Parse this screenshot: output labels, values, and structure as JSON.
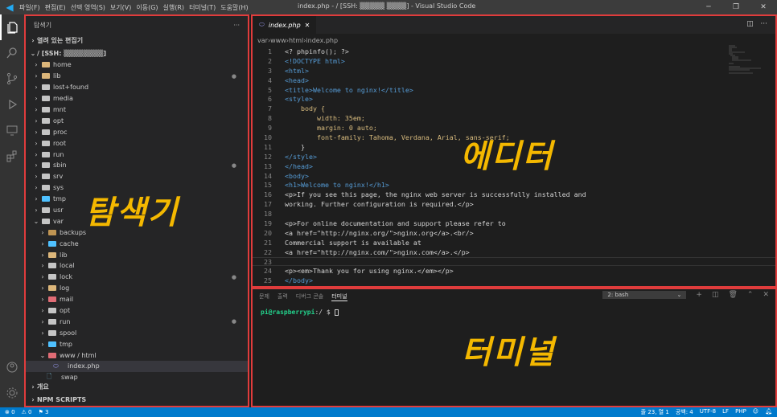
{
  "titlebar": {
    "menu": [
      "파일(F)",
      "편집(E)",
      "선택 영역(S)",
      "보기(V)",
      "이동(G)",
      "실행(R)",
      "터미널(T)",
      "도움말(H)"
    ],
    "title": "index.php - / [SSH: ▒▒▒▒▒ ▒▒▒▒] - Visual Studio Code"
  },
  "sidebar": {
    "title": "탐색기",
    "open_editors": "열려 있는 편집기",
    "root": "/ [SSH: ▒▒▒▒▒▒▒▒]",
    "items": [
      {
        "label": "home",
        "depth": 0,
        "color": "#dcb67a"
      },
      {
        "label": "lib",
        "depth": 0,
        "color": "#dcb67a",
        "dot": true
      },
      {
        "label": "lost+found",
        "depth": 0,
        "color": "#c5c5c5"
      },
      {
        "label": "media",
        "depth": 0,
        "color": "#c5c5c5"
      },
      {
        "label": "mnt",
        "depth": 0,
        "color": "#c5c5c5"
      },
      {
        "label": "opt",
        "depth": 0,
        "color": "#c5c5c5"
      },
      {
        "label": "proc",
        "depth": 0,
        "color": "#c5c5c5"
      },
      {
        "label": "root",
        "depth": 0,
        "color": "#c5c5c5"
      },
      {
        "label": "run",
        "depth": 0,
        "color": "#c5c5c5"
      },
      {
        "label": "sbin",
        "depth": 0,
        "color": "#c5c5c5",
        "dot": true
      },
      {
        "label": "srv",
        "depth": 0,
        "color": "#c5c5c5"
      },
      {
        "label": "sys",
        "depth": 0,
        "color": "#c5c5c5"
      },
      {
        "label": "tmp",
        "depth": 0,
        "color": "#4fc1ff"
      },
      {
        "label": "usr",
        "depth": 0,
        "color": "#c5c5c5"
      },
      {
        "label": "var",
        "depth": 0,
        "color": "#c5c5c5",
        "open": true
      },
      {
        "label": "backups",
        "depth": 1,
        "color": "#c09553"
      },
      {
        "label": "cache",
        "depth": 1,
        "color": "#4fc1ff"
      },
      {
        "label": "lib",
        "depth": 1,
        "color": "#dcb67a"
      },
      {
        "label": "local",
        "depth": 1,
        "color": "#c5c5c5"
      },
      {
        "label": "lock",
        "depth": 1,
        "color": "#c5c5c5",
        "dot": true
      },
      {
        "label": "log",
        "depth": 1,
        "color": "#dcb67a"
      },
      {
        "label": "mail",
        "depth": 1,
        "color": "#e06c75"
      },
      {
        "label": "opt",
        "depth": 1,
        "color": "#c5c5c5"
      },
      {
        "label": "run",
        "depth": 1,
        "color": "#c5c5c5",
        "dot": true
      },
      {
        "label": "spool",
        "depth": 1,
        "color": "#c5c5c5"
      },
      {
        "label": "tmp",
        "depth": 1,
        "color": "#4fc1ff"
      },
      {
        "label": "www / html",
        "depth": 1,
        "color": "#e06c75",
        "open": true
      },
      {
        "label": "index.php",
        "depth": 2,
        "file": true,
        "selected": true
      },
      {
        "label": "swap",
        "depth": 1,
        "file": true,
        "plain": true
      }
    ],
    "outline": "개요",
    "npm": "NPM SCRIPTS"
  },
  "editor": {
    "tab": "index.php",
    "breadcrumb": [
      "var",
      "www",
      "html",
      "index.php"
    ],
    "lines": [
      "<? phpinfo(); ?>",
      "<!DOCTYPE html>",
      "<html>",
      "<head>",
      "<title>Welcome to nginx!</title>",
      "<style>",
      "    body {",
      "        width: 35em;",
      "        margin: 0 auto;",
      "        font-family: Tahoma, Verdana, Arial, sans-serif;",
      "    }",
      "</style>",
      "</head>",
      "<body>",
      "<h1>Welcome to nginx!</h1>",
      "<p>If you see this page, the nginx web server is successfully installed and",
      "working. Further configuration is required.</p>",
      "",
      "<p>For online documentation and support please refer to",
      "<a href=\"http://nginx.org/\">nginx.org</a>.<br/>",
      "Commercial support is available at",
      "<a href=\"http://nginx.com/\">nginx.com</a>.</p>",
      "",
      "<p><em>Thank you for using nginx.</em></p>",
      "</body>"
    ],
    "current_line": 23
  },
  "panel": {
    "tabs": [
      "문제",
      "출력",
      "디버그 콘솔",
      "터미널"
    ],
    "active": 3,
    "shell": "2: bash",
    "prompt_user": "pi@raspberrypi",
    "prompt_rest": ":/ $ "
  },
  "statusbar": {
    "errors": "⊗ 0",
    "warnings": "⚠ 0",
    "ports": "⚑ 3",
    "position": "줄 23, 열 1",
    "spaces": "공백: 4",
    "encoding": "UTF-8",
    "eol": "LF",
    "language": "PHP"
  },
  "overlays": {
    "explorer": "탐색기",
    "editor": "에디터",
    "terminal": "터미널"
  }
}
